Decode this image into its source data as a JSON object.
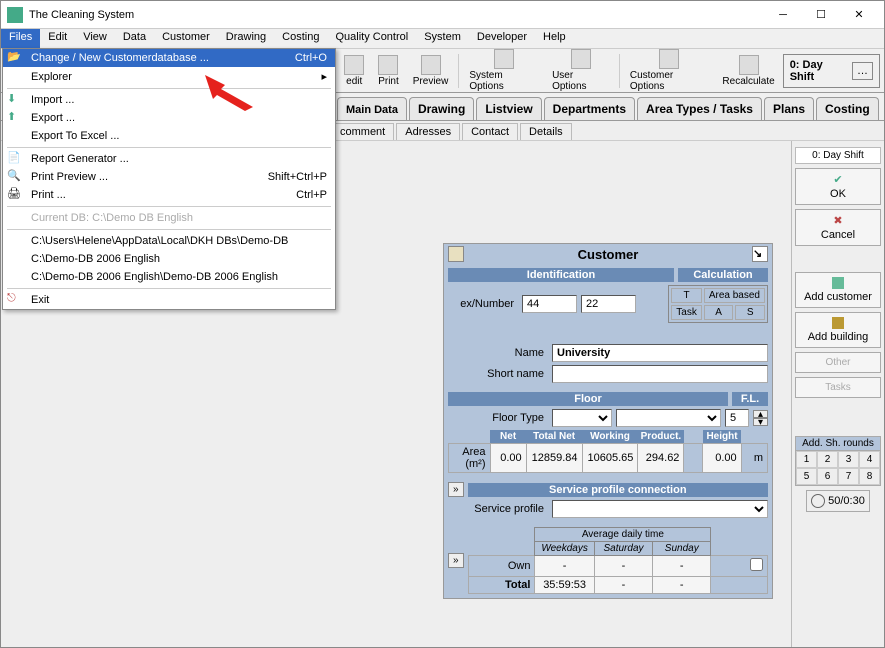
{
  "titlebar": {
    "title": "The Cleaning System"
  },
  "menubar": [
    "Files",
    "Edit",
    "View",
    "Data",
    "Customer",
    "Drawing",
    "Costing",
    "Quality Control",
    "System",
    "Developer",
    "Help"
  ],
  "fileMenu": {
    "changeDb": "Change / New Customerdatabase ...",
    "changeDbShortcut": "Ctrl+O",
    "explorer": "Explorer",
    "import": "Import ...",
    "export": "Export ...",
    "exportExcel": "Export To Excel ...",
    "reportGen": "Report Generator ...",
    "printPreview": "Print Preview ...",
    "printPreviewShortcut": "Shift+Ctrl+P",
    "print": "Print ...",
    "printShortcut": "Ctrl+P",
    "currentDb": "Current DB: C:\\Demo DB English",
    "path1": "C:\\Users\\Helene\\AppData\\Local\\DKH DBs\\Demo-DB",
    "path2": "C:\\Demo-DB 2006 English",
    "path3": "C:\\Demo-DB 2006 English\\Demo-DB 2006 English",
    "exit": "Exit"
  },
  "toolbar": {
    "edit": "edit",
    "print": "Print",
    "preview": "Preview",
    "sysopt": "System Options",
    "useropt": "User Options",
    "custopt": "Customer Options",
    "recalc": "Recalculate"
  },
  "shift": {
    "label": "0: Day Shift"
  },
  "tabs": [
    "Main Data",
    "Drawing",
    "Listview",
    "Departments",
    "Area Types / Tasks",
    "Plans",
    "Costing"
  ],
  "subtabs": [
    "comment",
    "Adresses",
    "Contact",
    "Details"
  ],
  "rightPanel": {
    "shift": "0: Day Shift",
    "ok": "OK",
    "cancel": "Cancel",
    "addCust": "Add customer",
    "addBld": "Add building",
    "other": "Other",
    "tasks": "Tasks",
    "roundsHdr": "Add. Sh. rounds",
    "r": [
      "1",
      "2",
      "3",
      "4",
      "5",
      "6",
      "7",
      "8"
    ],
    "timer": "50/0:30"
  },
  "customer": {
    "title": "Customer",
    "ident": "Identification",
    "calc": "Calculation",
    "indexLbl": "ex/Number",
    "idx1": "44",
    "idx2": "22",
    "tHead": "T",
    "areaBased": "Area based",
    "task": "Task",
    "a": "A",
    "s": "S",
    "nameLbl": "Name",
    "nameVal": "University",
    "shortLbl": "Short name",
    "shortVal": "",
    "floorHdr": "Floor",
    "fl": "F.L.",
    "floorTypeLbl": "Floor Type",
    "floorLvl": "5",
    "net": "Net",
    "totalNet": "Total Net",
    "working": "Working",
    "product": "Product.",
    "height": "Height",
    "areaLbl": "Area (m²)",
    "netV": "0.00",
    "totV": "12859.84",
    "workV": "10605.65",
    "prodV": "294.62",
    "heightV": "0.00",
    "m": "m",
    "svcHdr": "Service profile connection",
    "svcLbl": "Service profile",
    "dailyHdr": "Average daily time",
    "wkd": "Weekdays",
    "sat": "Saturday",
    "sun": "Sunday",
    "own": "Own",
    "ownW": "-",
    "ownSa": "-",
    "ownSu": "-",
    "total": "Total",
    "totW": "35:59:53",
    "totSa": "-",
    "totSu": "-",
    "expand": "»"
  }
}
